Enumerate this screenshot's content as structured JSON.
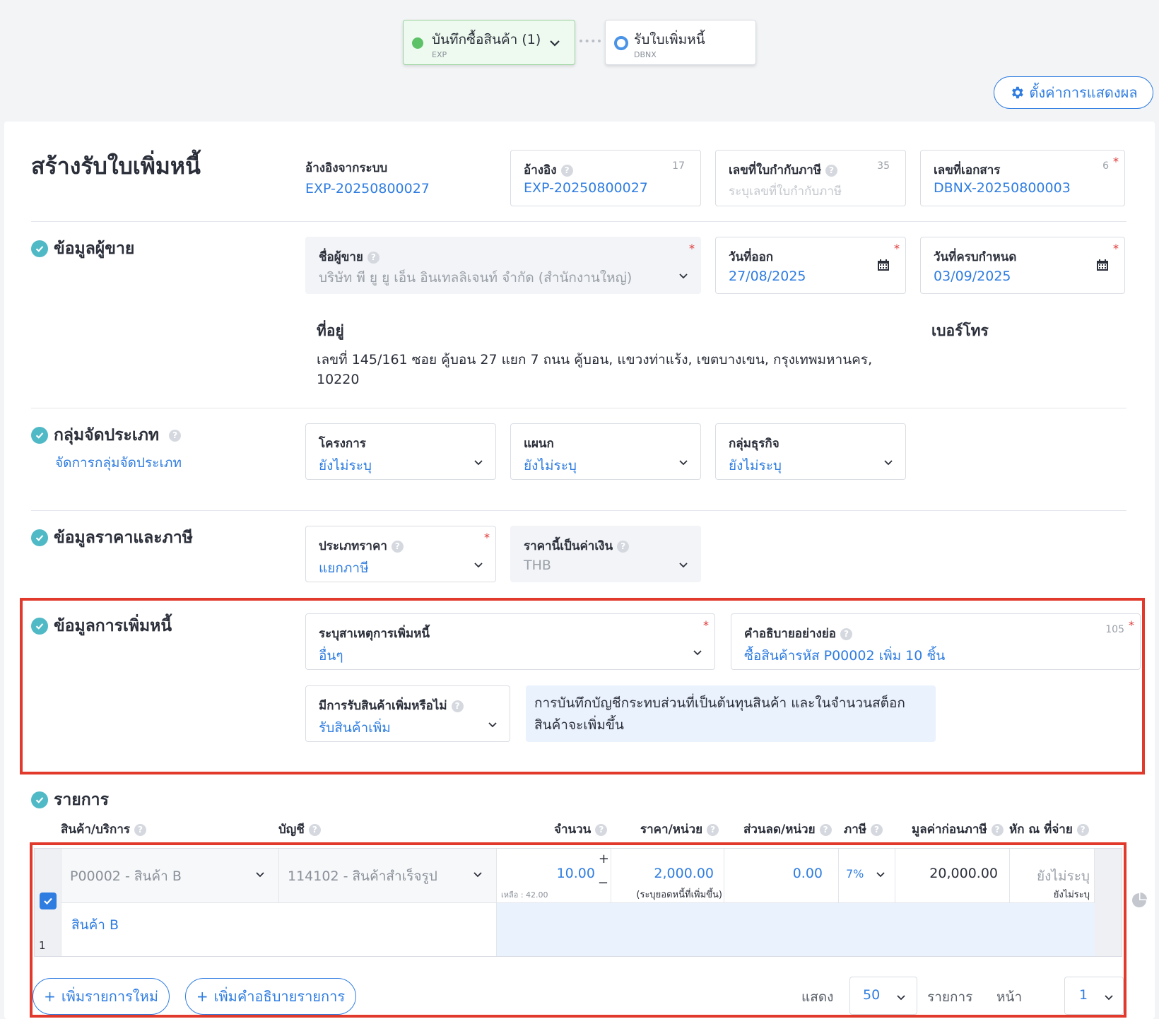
{
  "workflow": {
    "step1": {
      "title": "บันทึกซื้อสินค้า (1)",
      "code": "EXP"
    },
    "step2": {
      "title": "รับใบเพิ่มหนี้",
      "code": "DBNX"
    }
  },
  "settings_label": "ตั้งค่าการแสดงผล",
  "page_title": "สร้างรับใบเพิ่มหนี้",
  "header": {
    "system_ref_label": "อ้างอิงจากระบบ",
    "system_ref_value": "EXP-20250800027",
    "ref": {
      "label": "อ้างอิง",
      "value": "EXP-20250800027",
      "count": "17"
    },
    "tax_invoice": {
      "label": "เลขที่ใบกำกับภาษี",
      "placeholder": "ระบุเลขที่ใบกำกับภาษี",
      "count": "35"
    },
    "doc_no": {
      "label": "เลขที่เอกสาร",
      "value": "DBNX-20250800003",
      "count": "6"
    }
  },
  "seller": {
    "section": "ข้อมูลผู้ขาย",
    "name_label": "ชื่อผู้ขาย",
    "name_value": "บริษัท พี ยู ยู เอ็น อินเทลลิเจนท์ จำกัด (สำนักงานใหญ่)",
    "issue_date_label": "วันที่ออก",
    "issue_date": "27/08/2025",
    "due_date_label": "วันที่ครบกำหนด",
    "due_date": "03/09/2025",
    "address_label": "ที่อยู่",
    "address_line1": "เลขที่ 145/161 ซอย คู้บอน 27 แยก 7 ถนน คู้บอน, แขวงท่าแร้ง, เขตบางเขน, กรุงเทพมหานคร,",
    "address_line2": "10220",
    "phone_label": "เบอร์โทร"
  },
  "grouping": {
    "section": "กลุ่มจัดประเภท",
    "manage_link": "จัดการกลุ่มจัดประเภท",
    "project_label": "โครงการ",
    "project_value": "ยังไม่ระบุ",
    "dept_label": "แผนก",
    "dept_value": "ยังไม่ระบุ",
    "biz_label": "กลุ่มธุรกิจ",
    "biz_value": "ยังไม่ระบุ"
  },
  "pricing": {
    "section": "ข้อมูลราคาและภาษี",
    "price_type_label": "ประเภทราคา",
    "price_type_value": "แยกภาษี",
    "currency_label": "ราคานี้เป็นค่าเงิน",
    "currency_value": "THB"
  },
  "debit": {
    "section": "ข้อมูลการเพิ่มหนี้",
    "reason_label": "ระบุสาเหตุการเพิ่มหนี้",
    "reason_value": "อื่นๆ",
    "desc_label": "คำอธิบายอย่างย่อ",
    "desc_value": "ซื้อสินค้ารหัส P00002 เพิ่ม 10 ชิ้น",
    "desc_count": "105",
    "receive_label": "มีการรับสินค้าเพิ่มหรือไม่",
    "receive_value": "รับสินค้าเพิ่ม",
    "info_line1": "การบันทึกบัญชีกระทบส่วนที่เป็นต้นทุนสินค้า และในจำนวนสต็อก",
    "info_line2": "สินค้าจะเพิ่มขึ้น"
  },
  "items": {
    "section": "รายการ",
    "columns": {
      "product": "สินค้า/บริการ",
      "account": "บัญชี",
      "qty": "จำนวน",
      "price": "ราคา/หน่วย",
      "discount": "ส่วนลด/หน่วย",
      "tax": "ภาษี",
      "pretax": "มูลค่าก่อนภาษี",
      "wht": "หัก ณ ที่จ่าย"
    },
    "row": {
      "index": "1",
      "product": "P00002 - สินค้า B",
      "account": "114102 - สินค้าสำเร็จรูป",
      "qty": "10.00",
      "remaining": "เหลือ : 42.00",
      "price": "2,000.00",
      "price_note": "(ระบุยอดหนี้ที่เพิ่มขึ้น)",
      "discount": "0.00",
      "tax": "7%",
      "pretax": "20,000.00",
      "wht": "ยังไม่ระบุ",
      "wht_sub": "ยังไม่ระบุ",
      "description": "สินค้า B"
    },
    "add_item": "เพิ่มรายการใหม่",
    "add_desc": "เพิ่มคำอธิบายรายการ",
    "show_label": "แสดง",
    "page_size": "50",
    "items_label": "รายการ",
    "page_label": "หน้า",
    "page_no": "1"
  },
  "colors": {
    "accent": "#2f7de1",
    "check": "#4fb9c6",
    "highlight": "#e1392b",
    "active_step": "#5cc167"
  }
}
